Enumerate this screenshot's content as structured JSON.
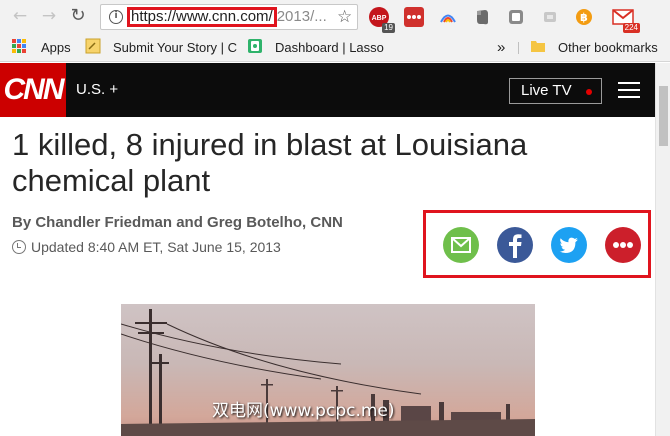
{
  "browser": {
    "url_highlighted": "https://www.cnn.com/",
    "url_rest": "2013/...",
    "extensions": [
      {
        "name": "abp-icon",
        "color": "#c4161c",
        "badge": "19"
      },
      {
        "name": "dots-ext-icon",
        "color": "#d0312d",
        "badge": ""
      },
      {
        "name": "rainbow-ext-icon",
        "color": "#ffffff",
        "badge": ""
      },
      {
        "name": "evernote-icon",
        "color": "#6b6b6b",
        "badge": ""
      },
      {
        "name": "square-ext-icon",
        "color": "#8a8a8a",
        "badge": ""
      },
      {
        "name": "gray-ext-icon",
        "color": "#c8c8c8",
        "badge": ""
      },
      {
        "name": "bitcoin-ext-icon",
        "color": "#f39c12",
        "badge": ""
      },
      {
        "name": "gmail-icon",
        "color": "#d93025",
        "badge": "224"
      }
    ]
  },
  "bookmarks": {
    "apps": "Apps",
    "submit_story": "Submit Your Story | C",
    "dashboard": "Dashboard | Lasso",
    "overflow": "»",
    "other": "Other bookmarks"
  },
  "cnn": {
    "logo": "CNN",
    "edition": "U.S. +",
    "live_tv": "Live TV",
    "colors": {
      "brand_red": "#cc0000",
      "header_bg": "#0c0c0c"
    }
  },
  "article": {
    "headline": "1 killed, 8 injured in blast at Louisiana chemical plant",
    "byline": "By Chandler Friedman and Greg Botelho, CNN",
    "updated": "Updated 8:40 AM ET, Sat June 15, 2013"
  },
  "share": [
    {
      "name": "email-share-icon",
      "color": "#6fbf4b"
    },
    {
      "name": "facebook-share-icon",
      "color": "#3b5998"
    },
    {
      "name": "twitter-share-icon",
      "color": "#1da1f2"
    },
    {
      "name": "more-share-icon",
      "color": "#cc1f2b"
    }
  ],
  "watermark": "双电网(www.pcpc.me)"
}
